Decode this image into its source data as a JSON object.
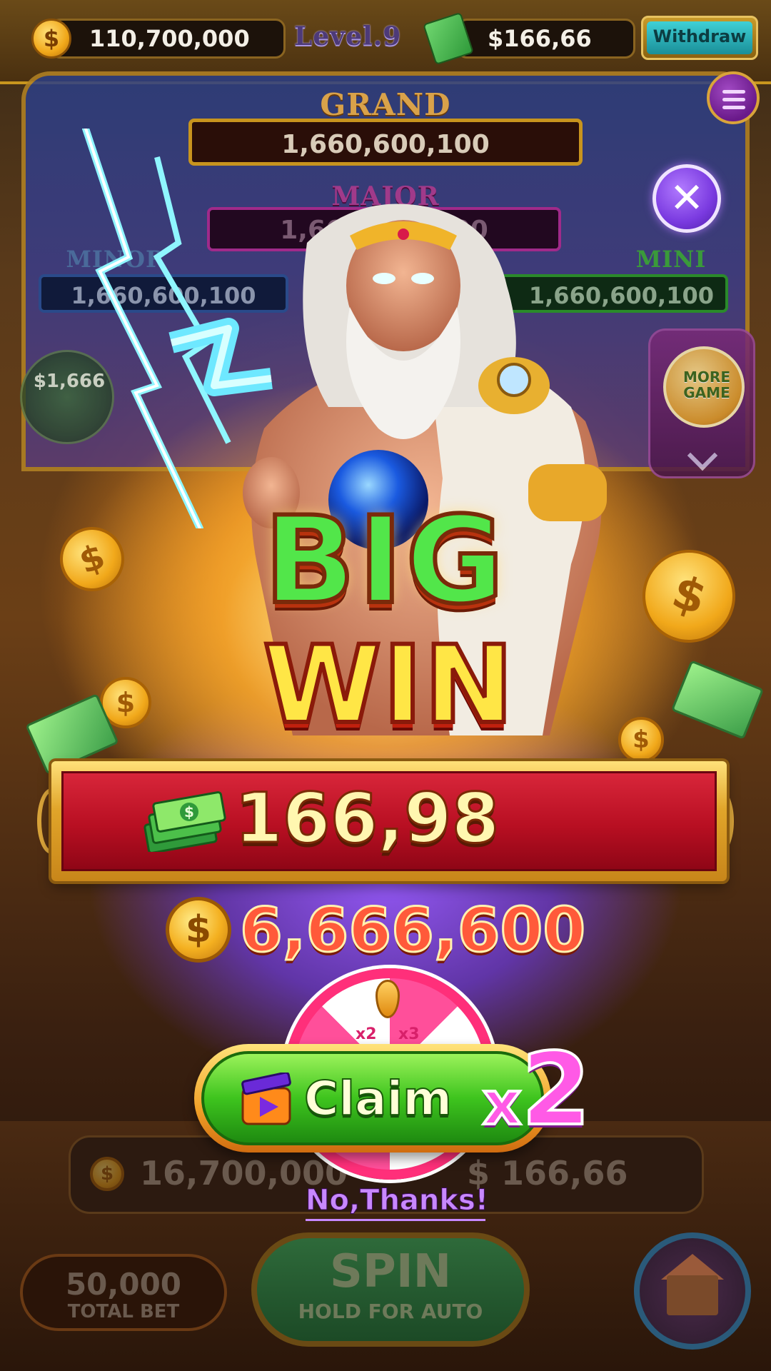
{
  "header": {
    "coin_balance": "110,700,000",
    "level": "Level.9",
    "cash_balance": "$166,66",
    "withdraw_label": "Withdraw"
  },
  "jackpots": {
    "grand": {
      "label": "GRAND",
      "value": "1,660,600,100"
    },
    "major": {
      "label": "MAJOR",
      "value": "1,660,600,100"
    },
    "minor": {
      "label": "MINOR",
      "value": "1,660,600,100"
    },
    "mini": {
      "label": "MINI",
      "value": "1,660,600,100"
    }
  },
  "side": {
    "bonus_value": "$1,666",
    "more_game_label": "MORE GAME"
  },
  "win_popup": {
    "title_line1": "BIG",
    "title_line2": "WIN",
    "cash_amount": "166,98",
    "coin_amount": "6,666,600",
    "wheel_labels": [
      "x2",
      "x3"
    ],
    "claim_label": "Claim",
    "multiplier_x": "x",
    "multiplier_n": "2",
    "no_thanks_label": "No,Thanks!"
  },
  "bottom": {
    "coins": "16,700,000",
    "cash": "$ 166,66",
    "total_bet_value": "50,000",
    "total_bet_label": "TOTAL BET",
    "spin_label": "SPIN",
    "spin_sub_label": "HOLD FOR AUTO"
  },
  "icons": {
    "coin": "dollar-coin-icon",
    "cash": "cash-stack-icon",
    "close": "close-icon",
    "menu": "menu-icon",
    "video": "video-ad-icon",
    "home": "house-icon",
    "chevron": "chevron-down-icon"
  },
  "colors": {
    "big_text": "#52e64a",
    "win_text": "#ffe646",
    "banner_red": "#c8152a",
    "claim_green": "#3ec41e",
    "multiplier_pink": "#ff5ae6",
    "no_thanks_purple": "#c888ff"
  }
}
